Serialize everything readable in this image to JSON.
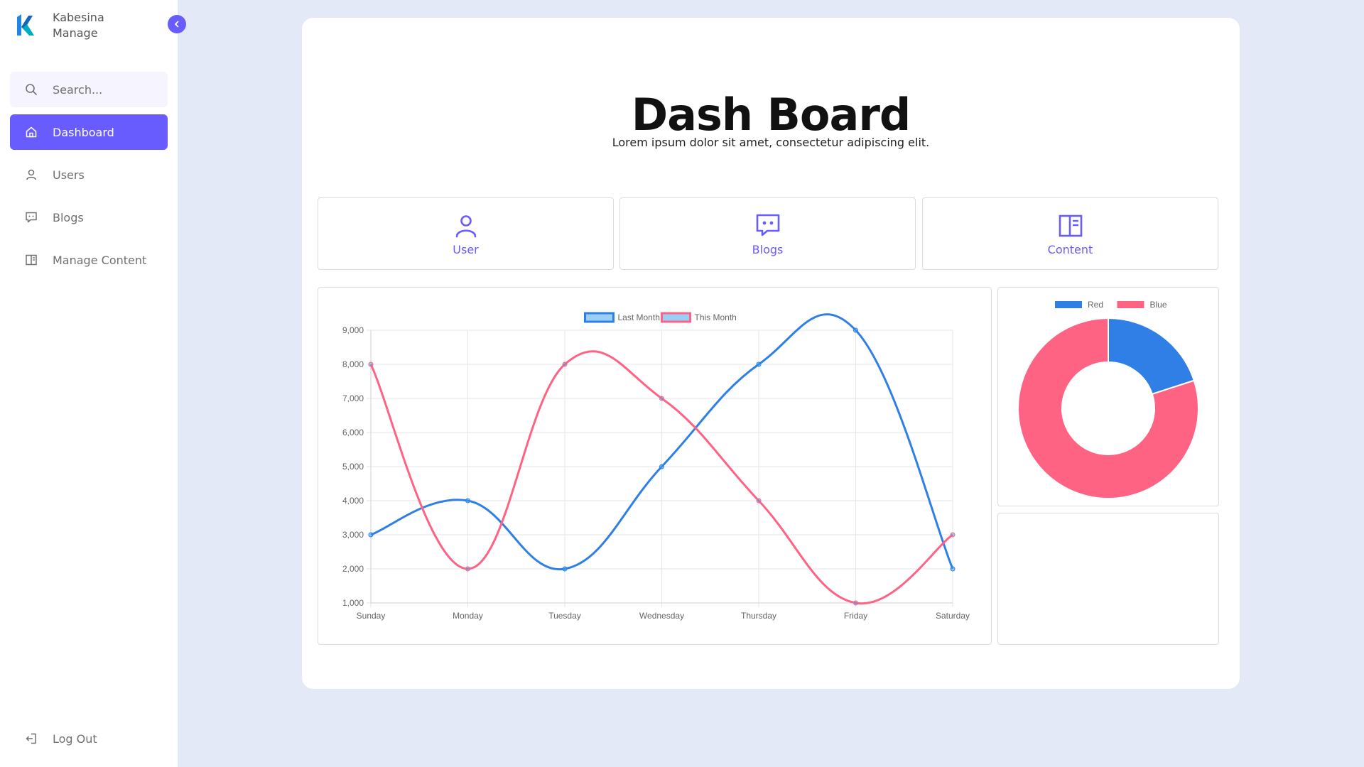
{
  "brand": {
    "line1": "Kabesina",
    "line2": "Manage"
  },
  "search": {
    "placeholder": "Search..."
  },
  "nav": {
    "dashboard": "Dashboard",
    "users": "Users",
    "blogs": "Blogs",
    "manage_content": "Manage Content"
  },
  "logout": "Log Out",
  "header": {
    "title": "Dash Board",
    "subtitle": "Lorem ipsum dolor sit amet, consectetur adipiscing elit."
  },
  "stat_cards": {
    "user": "User",
    "blogs": "Blogs",
    "content": "Content"
  },
  "colors": {
    "accent": "#695cfe",
    "blue": "#2f7fe6",
    "pink": "#ff6384",
    "bg": "#e4e9f7"
  },
  "chart_data": [
    {
      "type": "line",
      "categories": [
        "Sunday",
        "Monday",
        "Tuesday",
        "Wednesday",
        "Thursday",
        "Friday",
        "Saturday"
      ],
      "series": [
        {
          "name": "Last Month",
          "values": [
            3000,
            4000,
            2000,
            5000,
            8000,
            9000,
            2000
          ],
          "color": "#2f7fe6"
        },
        {
          "name": "This Month",
          "values": [
            8000,
            2000,
            8000,
            7000,
            4000,
            1000,
            3000
          ],
          "color": "#ff6384"
        }
      ],
      "ylim": [
        1000,
        9000
      ],
      "yticks": [
        "1,000",
        "2,000",
        "3,000",
        "4,000",
        "5,000",
        "6,000",
        "7,000",
        "8,000",
        "9,000"
      ],
      "grid": true,
      "legend": "top"
    },
    {
      "type": "doughnut",
      "labels": [
        "Red",
        "Blue"
      ],
      "values": [
        20,
        80
      ],
      "colors": [
        "#2f7fe6",
        "#ff6384"
      ],
      "legend": "top"
    }
  ]
}
